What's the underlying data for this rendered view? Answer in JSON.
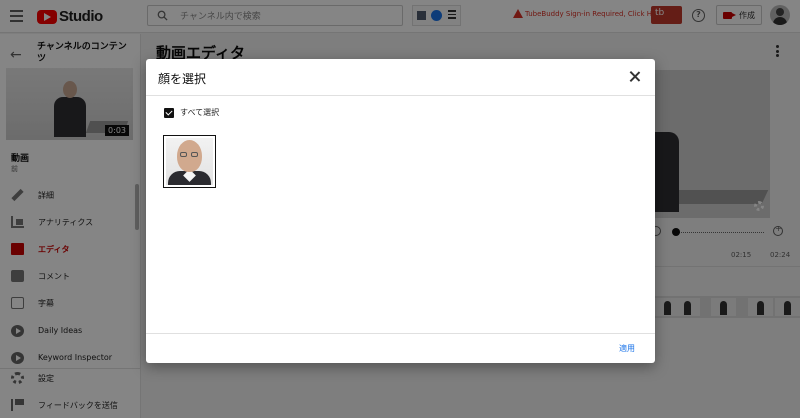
{
  "header": {
    "logo_text": "Studio",
    "search_placeholder": "チャンネル内で検索",
    "tubebuddy_warning": "TubeBuddy Sign-in Required, Click Here",
    "tubebuddy_button": "tb",
    "create_label": "作成"
  },
  "sidebar": {
    "channel_title": "チャンネルのコンテンツ",
    "thumbnail_duration": "0:03",
    "video_label": "動画",
    "video_sub": "前",
    "items": [
      {
        "label": "詳細",
        "icon": "pencil-icon"
      },
      {
        "label": "アナリティクス",
        "icon": "analytics-icon"
      },
      {
        "label": "エディタ",
        "icon": "clapper-icon",
        "active": true
      },
      {
        "label": "コメント",
        "icon": "comment-icon"
      },
      {
        "label": "字幕",
        "icon": "subtitles-icon"
      },
      {
        "label": "Daily Ideas",
        "icon": "play-circle-icon"
      },
      {
        "label": "Keyword Inspector",
        "icon": "play-circle-icon"
      }
    ],
    "footer": [
      {
        "label": "設定",
        "icon": "gear-icon"
      },
      {
        "label": "フィードバックを送信",
        "icon": "feedback-icon"
      }
    ]
  },
  "main": {
    "title": "動画エディタ",
    "timeline": {
      "time_a": "02:15",
      "time_b": "02:24"
    }
  },
  "dialog": {
    "title": "顔を選択",
    "select_all_label": "すべて選択",
    "select_all_checked": true,
    "apply_label": "適用"
  },
  "colors": {
    "accent_red": "#cc0000",
    "link_blue": "#1a73e8",
    "overlay": "rgba(0,0,0,0.48)"
  }
}
